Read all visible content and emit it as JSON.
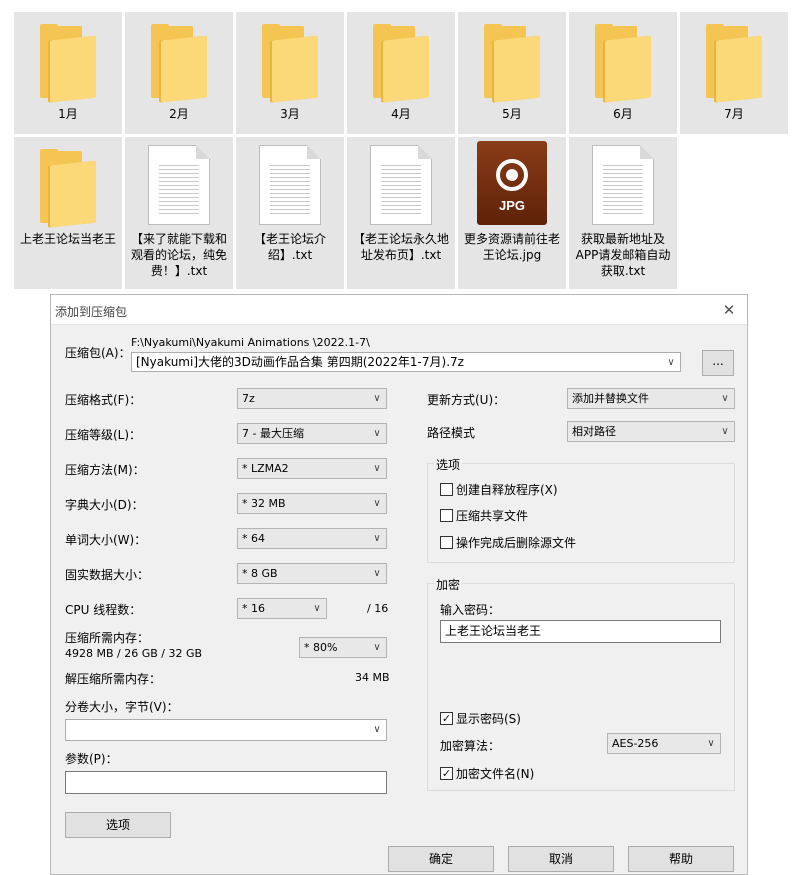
{
  "explorer": {
    "items": [
      {
        "name": "1月",
        "type": "folder"
      },
      {
        "name": "2月",
        "type": "folder"
      },
      {
        "name": "3月",
        "type": "folder"
      },
      {
        "name": "4月",
        "type": "folder"
      },
      {
        "name": "5月",
        "type": "folder"
      },
      {
        "name": "6月",
        "type": "folder"
      },
      {
        "name": "7月",
        "type": "folder"
      },
      {
        "name": "上老王论坛当老王",
        "type": "folder"
      },
      {
        "name": "【来了就能下载和观看的论坛，纯免费！】.txt",
        "type": "txt"
      },
      {
        "name": "【老王论坛介绍】.txt",
        "type": "txt"
      },
      {
        "name": "【老王论坛永久地址发布页】.txt",
        "type": "txt"
      },
      {
        "name": "更多资源请前往老王论坛.jpg",
        "type": "jpg",
        "badge": "JPG"
      },
      {
        "name": "获取最新地址及APP请发邮箱自动获取.txt",
        "type": "txt"
      }
    ]
  },
  "dialog": {
    "title": "添加到压缩包",
    "close_glyph": "✕",
    "archive_label": "压缩包(A)：",
    "archive_path": "F:\\Nyakumi\\Nyakumi Animations \\2022.1-7\\",
    "archive_name": "[Nyakumi]大佬的3D动画作品合集 第四期(2022年1-7月).7z",
    "browse_label": "...",
    "format_label": "压缩格式(F)：",
    "format_value": "7z",
    "level_label": "压缩等级(L)：",
    "level_value": "7 - 最大压缩",
    "method_label": "压缩方法(M)：",
    "method_value": "* LZMA2",
    "dict_label": "字典大小(D)：",
    "dict_value": "* 32 MB",
    "word_label": "单词大小(W)：",
    "word_value": "* 64",
    "solid_label": "固实数据大小：",
    "solid_value": "* 8 GB",
    "threads_label": "CPU 线程数：",
    "threads_value": "* 16",
    "threads_max": "/ 16",
    "mem_comp_label": "压缩所需内存：",
    "mem_comp_value": "4928 MB / 26 GB / 32 GB",
    "mem_percent": "* 80%",
    "mem_decomp_label": "解压缩所需内存：",
    "mem_decomp_value": "34 MB",
    "volume_label": "分卷大小，字节(V)：",
    "volume_value": "",
    "params_label": "参数(P)：",
    "params_value": "",
    "options_button": "选项",
    "update_label": "更新方式(U)：",
    "update_value": "添加并替换文件",
    "path_label": "路径模式",
    "path_value": "相对路径",
    "options_group": "选项",
    "opt_sfx": "创建自释放程序(X)",
    "opt_shared": "压缩共享文件",
    "opt_delete": "操作完成后删除源文件",
    "encrypt_group": "加密",
    "password_label": "输入密码：",
    "password_value": "上老王论坛当老王",
    "show_password": "显示密码(S)",
    "enc_method_label": "加密算法：",
    "enc_method_value": "AES-256",
    "enc_names": "加密文件名(N)",
    "ok": "确定",
    "cancel": "取消",
    "help": "帮助"
  }
}
